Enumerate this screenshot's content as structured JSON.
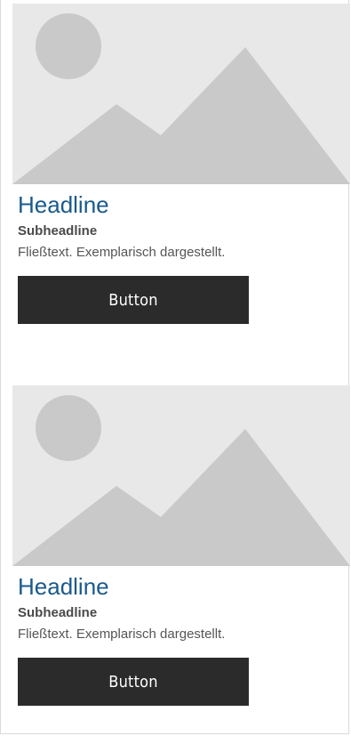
{
  "cards": [
    {
      "headline": "Headline",
      "subheadline": "Subheadline",
      "body": "Fließtext. Exemplarisch dargestellt.",
      "button_label": "Button",
      "image_icon": "image-placeholder-icon"
    },
    {
      "headline": "Headline",
      "subheadline": "Subheadline",
      "body": "Fließtext. Exemplarisch dargestellt.",
      "button_label": "Button",
      "image_icon": "image-placeholder-icon"
    }
  ],
  "colors": {
    "headline": "#1a5a8c",
    "button_bg": "#2b2b2b",
    "placeholder_bg": "#e8e8e8",
    "placeholder_shapes": "#c9c9c9"
  }
}
